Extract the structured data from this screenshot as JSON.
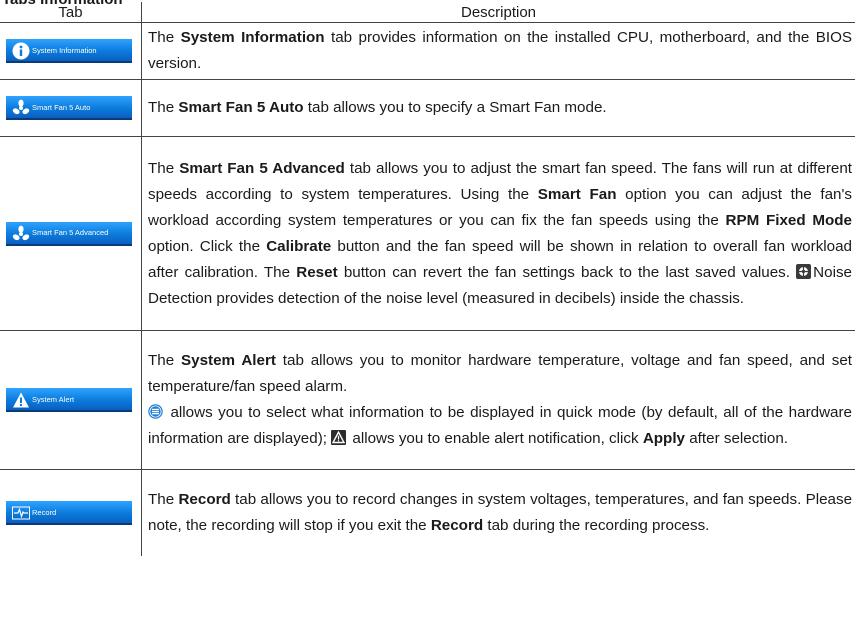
{
  "heading": "Tabs Information",
  "columns": {
    "tab": "Tab",
    "description": "Description"
  },
  "rows": [
    {
      "tab_label": "System Information",
      "icon": "info-icon",
      "desc": [
        {
          "t": "The "
        },
        {
          "b": "System Information"
        },
        {
          "t": " tab provides information on the installed CPU, motherboard, and the BIOS version."
        }
      ]
    },
    {
      "tab_label": "Smart Fan 5 Auto",
      "icon": "fan-icon",
      "desc": [
        {
          "t": "The "
        },
        {
          "b": "Smart Fan 5 Auto"
        },
        {
          "t": " tab allows you to specify a Smart Fan mode."
        }
      ]
    },
    {
      "tab_label": "Smart Fan 5 Advanced",
      "icon": "fan-icon",
      "desc": [
        {
          "t": "The "
        },
        {
          "b": "Smart Fan 5 Advanced"
        },
        {
          "t": " tab allows you to adjust the smart fan speed. The fans will run at different speeds according to system temperatures. Using the "
        },
        {
          "b": "Smart Fan"
        },
        {
          "t": " option you can adjust the fan's workload according system temperatures or you can fix the fan speeds using the "
        },
        {
          "b": "RPM Fixed Mode"
        },
        {
          "t": " option. Click the "
        },
        {
          "b": "Calibrate"
        },
        {
          "t": " button and the fan speed will be shown in relation to overall fan workload after calibration. The "
        },
        {
          "b": "Reset"
        },
        {
          "t": " button can revert the fan settings back to the last saved values. "
        },
        {
          "icon": "noise-icon"
        },
        {
          "t": "Noise Detection provides detection of the noise level (measured in decibels) inside the chassis."
        }
      ]
    },
    {
      "tab_label": "System Alert",
      "icon": "alert-icon",
      "desc": [
        {
          "t": "The "
        },
        {
          "b": "System Alert"
        },
        {
          "t": " tab allows you to monitor hardware temperature, voltage and fan speed, and set temperature/fan speed alarm."
        },
        {
          "br": true
        },
        {
          "icon": "list-icon"
        },
        {
          "t": " allows you to select what information to be displayed in quick mode (by default, all of the hardware information are displayed); "
        },
        {
          "icon": "warning-icon"
        },
        {
          "t": " allows you to enable alert notification, click "
        },
        {
          "b": "Apply"
        },
        {
          "t": " after selection."
        }
      ]
    },
    {
      "tab_label": "Record",
      "icon": "record-icon",
      "desc": [
        {
          "t": "The "
        },
        {
          "b": "Record"
        },
        {
          "t": " tab allows you to record changes in system voltages, temperatures, and fan speeds. Please note, the recording will stop if you exit the "
        },
        {
          "b": "Record"
        },
        {
          "t": " tab during the recording process."
        }
      ]
    }
  ]
}
